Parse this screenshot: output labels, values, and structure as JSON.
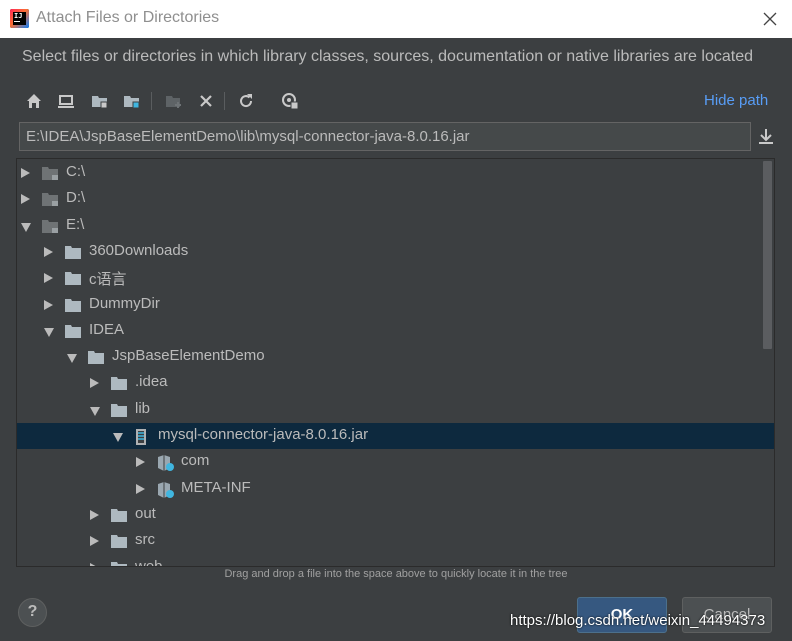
{
  "window": {
    "title": "Attach Files or Directories",
    "app_icon": "intellij-idea-icon",
    "close_icon": "close-icon"
  },
  "description": "Select files or directories in which library classes, sources, documentation or native libraries are located",
  "toolbar": {
    "icons": [
      "home-icon",
      "desktop-icon",
      "project-folder-icon",
      "module-folder-icon",
      "new-folder-icon",
      "delete-icon",
      "refresh-icon",
      "show-hidden-icon"
    ],
    "hide_path_label": "Hide path"
  },
  "path_field": {
    "value": "E:\\IDEA\\JspBaseElementDemo\\lib\\mysql-connector-java-8.0.16.jar",
    "download_icon": "download-icon"
  },
  "tree": {
    "items": [
      {
        "label": "C:\\",
        "depth": 0,
        "expanded": false,
        "icon": "drive-icon"
      },
      {
        "label": "D:\\",
        "depth": 0,
        "expanded": false,
        "icon": "drive-icon"
      },
      {
        "label": "E:\\",
        "depth": 0,
        "expanded": true,
        "icon": "drive-icon"
      },
      {
        "label": "360Downloads",
        "depth": 1,
        "expanded": false,
        "icon": "folder-icon"
      },
      {
        "label": "c语言",
        "depth": 1,
        "expanded": false,
        "icon": "folder-icon"
      },
      {
        "label": "DummyDir",
        "depth": 1,
        "expanded": false,
        "icon": "folder-icon"
      },
      {
        "label": "IDEA",
        "depth": 1,
        "expanded": true,
        "icon": "folder-icon"
      },
      {
        "label": "JspBaseElementDemo",
        "depth": 2,
        "expanded": true,
        "icon": "folder-icon"
      },
      {
        "label": ".idea",
        "depth": 3,
        "expanded": false,
        "icon": "folder-icon"
      },
      {
        "label": "lib",
        "depth": 3,
        "expanded": true,
        "icon": "folder-icon"
      },
      {
        "label": "mysql-connector-java-8.0.16.jar",
        "depth": 4,
        "expanded": true,
        "icon": "jar-icon",
        "selected": true
      },
      {
        "label": "com",
        "depth": 5,
        "expanded": false,
        "icon": "package-icon"
      },
      {
        "label": "META-INF",
        "depth": 5,
        "expanded": false,
        "icon": "package-icon"
      },
      {
        "label": "out",
        "depth": 3,
        "expanded": false,
        "icon": "folder-icon"
      },
      {
        "label": "src",
        "depth": 3,
        "expanded": false,
        "icon": "folder-icon"
      },
      {
        "label": "web",
        "depth": 3,
        "expanded": false,
        "icon": "folder-icon"
      }
    ]
  },
  "hint": "Drag and drop a file into the space above to quickly locate it in the tree",
  "buttons": {
    "help_label": "?",
    "ok_label": "OK",
    "cancel_label": "Cancel"
  },
  "watermark": "https://blog.csdn.net/weixin_44494373",
  "colors": {
    "background": "#3c3f41",
    "selection": "#0d293e",
    "link": "#589df6",
    "primary_button": "#365880"
  }
}
